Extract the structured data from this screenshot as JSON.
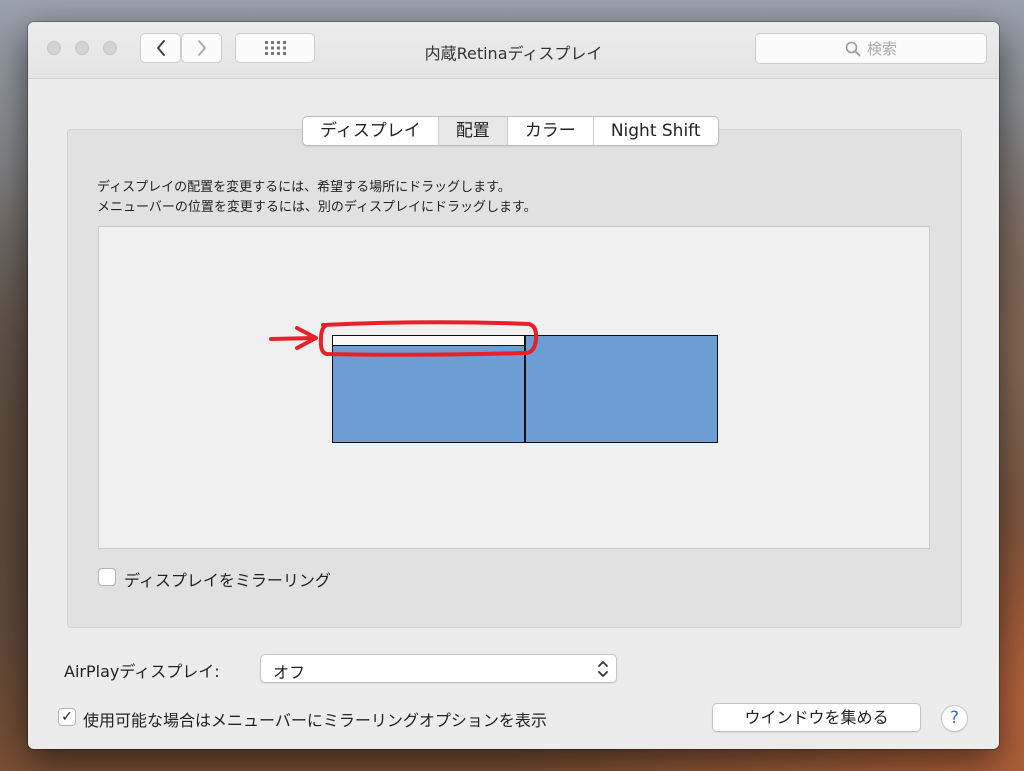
{
  "window": {
    "title": "内蔵Retinaディスプレイ",
    "search_placeholder": "検索"
  },
  "tabs": [
    {
      "label": "ディスプレイ",
      "active": false
    },
    {
      "label": "配置",
      "active": true
    },
    {
      "label": "カラー",
      "active": false
    },
    {
      "label": "Night Shift",
      "active": false
    }
  ],
  "arrangement": {
    "instruction_line1": "ディスプレイの配置を変更するには、希望する場所にドラッグします。",
    "instruction_line2": "メニューバーの位置を変更するには、別のディスプレイにドラッグします。",
    "display_color": "#6d9dd2",
    "annotation_color": "#e8202a"
  },
  "mirror": {
    "label": "ディスプレイをミラーリング",
    "checked": false
  },
  "airplay": {
    "label": "AirPlayディスプレイ:",
    "value": "オフ"
  },
  "show_options": {
    "label": "使用可能な場合はメニューバーにミラーリングオプションを表示",
    "checked": true,
    "check_glyph": "✓"
  },
  "gather_button": "ウインドウを集める",
  "help_label": "?"
}
